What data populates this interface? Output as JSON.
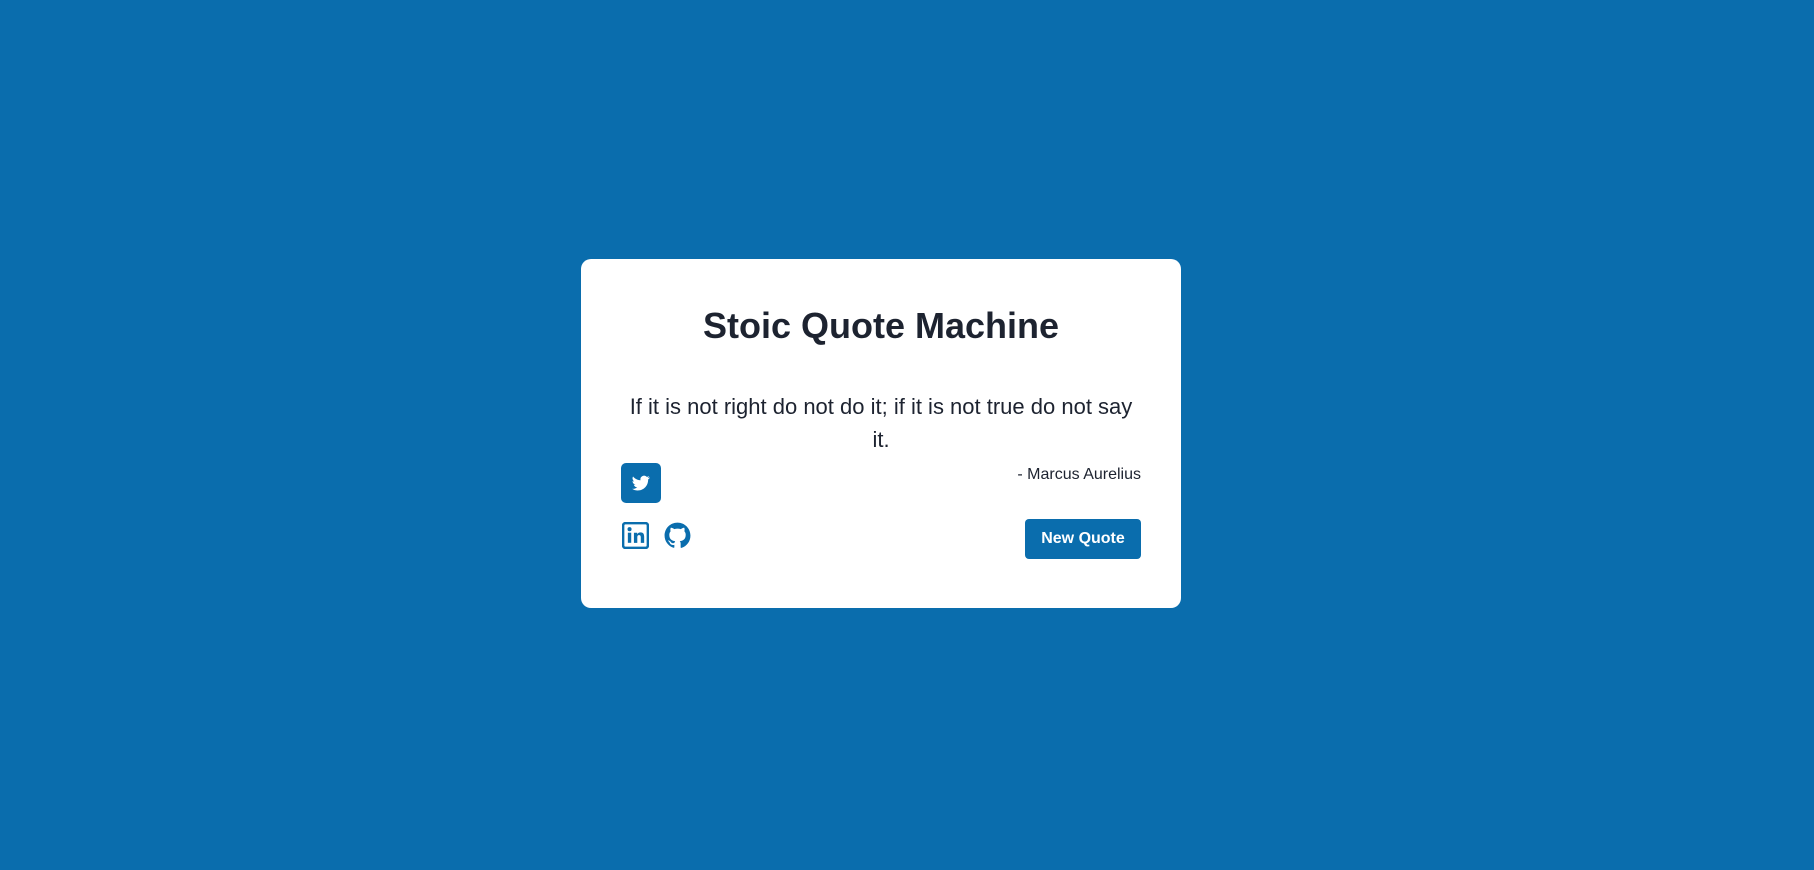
{
  "colors": {
    "background": "#0a6dad",
    "card": "#ffffff",
    "text": "#1d2330",
    "accent": "#0a6dad",
    "button_text": "#ffffff"
  },
  "card": {
    "title": "Stoic Quote Machine",
    "quote": {
      "text": "If it is not right do not do it; if it is not true do not say it.",
      "author": "- Marcus Aurelius"
    },
    "actions": {
      "tweet_icon": "twitter-icon",
      "new_quote_label": "New Quote"
    },
    "social": {
      "linkedin_icon": "linkedin-icon",
      "github_icon": "github-icon"
    }
  }
}
